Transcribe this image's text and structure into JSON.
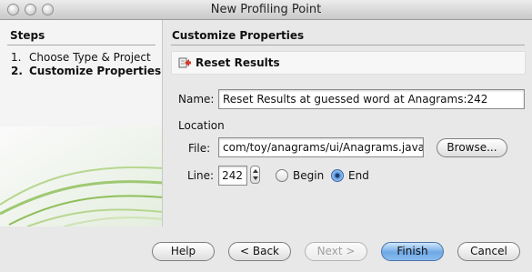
{
  "window": {
    "title": "New Profiling Point"
  },
  "steps": {
    "heading": "Steps",
    "items": [
      {
        "num": "1.",
        "label": "Choose Type & Project"
      },
      {
        "num": "2.",
        "label": "Customize Properties"
      }
    ]
  },
  "panel": {
    "heading": "Customize Properties",
    "type_label": "Reset Results",
    "name_label": "Name:",
    "name_value": "Reset Results at guessed word at Anagrams:242",
    "location_label": "Location",
    "file_label": "File:",
    "file_value": "com/toy/anagrams/ui/Anagrams.java",
    "browse_label": "Browse...",
    "line_label": "Line:",
    "line_value": "242",
    "begin_label": "Begin",
    "end_label": "End"
  },
  "buttons": {
    "help": "Help",
    "back": "< Back",
    "next": "Next >",
    "finish": "Finish",
    "cancel": "Cancel"
  },
  "colors": {
    "accent": "#6fa9e6",
    "swoosh": "#8fbf5a"
  }
}
